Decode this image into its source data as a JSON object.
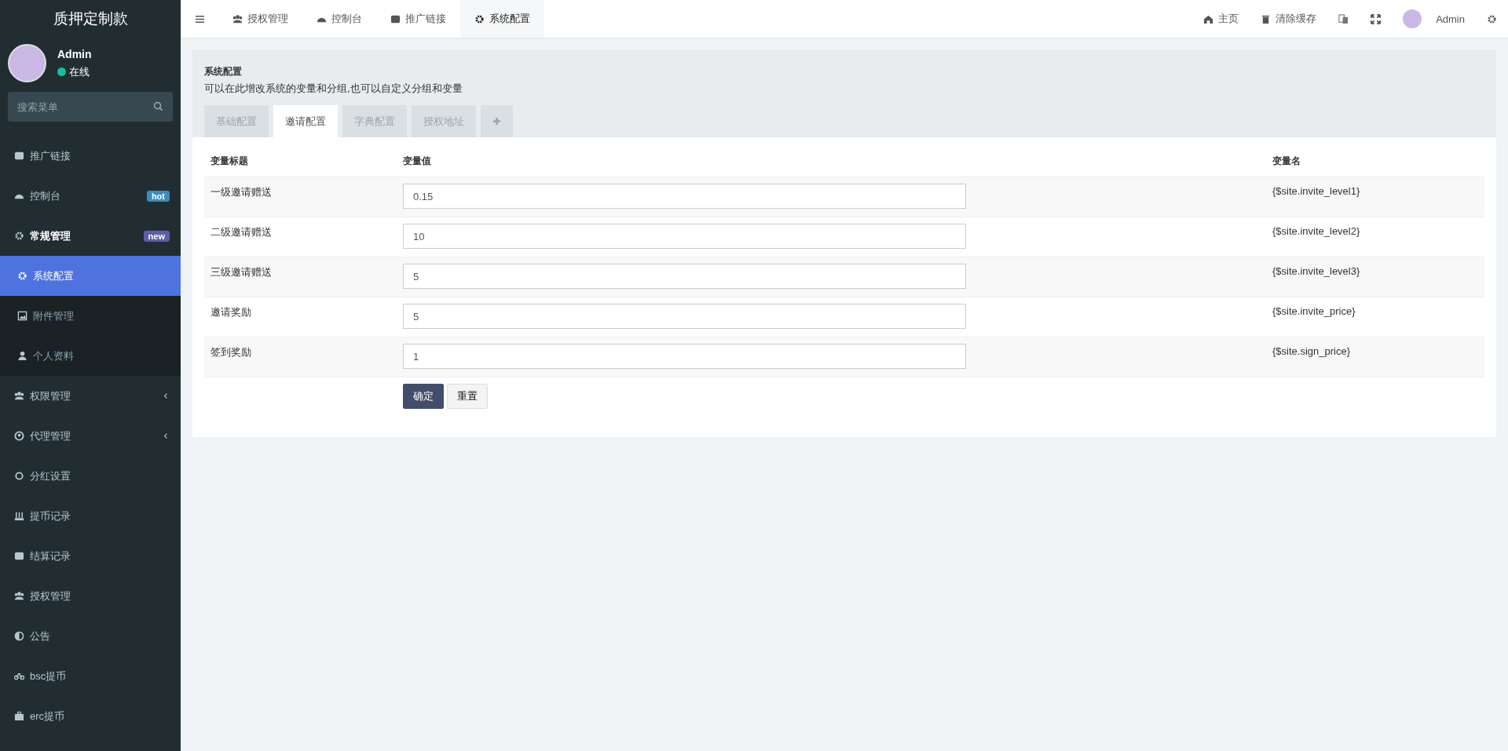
{
  "brand": "质押定制款",
  "user": {
    "name": "Admin",
    "status": "在线"
  },
  "sidebar": {
    "search": {
      "placeholder": "搜索菜单"
    },
    "items": [
      {
        "label": "推广链接",
        "selected": false
      },
      {
        "label": "控制台",
        "badge": {
          "label": "hot",
          "color": "#3c8dbc"
        },
        "selected": false
      },
      {
        "label": "常规管理",
        "badge": {
          "label": "new",
          "color": "#605ca8"
        },
        "selected": false,
        "expanded": true,
        "children": [
          {
            "label": "系统配置",
            "selected": true
          },
          {
            "label": "附件管理",
            "selected": false
          },
          {
            "label": "个人资料",
            "selected": false
          }
        ]
      },
      {
        "label": "权限管理",
        "selected": false,
        "expanded": false,
        "has_children": true
      },
      {
        "label": "代理管理",
        "selected": false,
        "expanded": false,
        "has_children": true
      },
      {
        "label": "分红设置",
        "selected": false
      },
      {
        "label": "提币记录",
        "selected": false
      },
      {
        "label": "结算记录",
        "selected": false
      },
      {
        "label": "授权管理",
        "selected": false
      },
      {
        "label": "公告",
        "selected": false
      },
      {
        "label": "bsc提币",
        "selected": false
      },
      {
        "label": "erc提币",
        "selected": false
      }
    ]
  },
  "top_tabs": [
    {
      "label": "授权管理",
      "selected": false
    },
    {
      "label": "控制台",
      "selected": false
    },
    {
      "label": "推广链接",
      "selected": false
    },
    {
      "label": "系统配置",
      "selected": true
    }
  ],
  "top_right": {
    "home": "主页",
    "clear_cache": "清除缓存",
    "user": "Admin"
  },
  "panel": {
    "title": "系统配置",
    "description": "可以在此增改系统的变量和分组,也可以自定义分组和变量",
    "tabs": [
      {
        "label": "基础配置",
        "selected": false
      },
      {
        "label": "邀请配置",
        "selected": true
      },
      {
        "label": "字典配置",
        "selected": false
      },
      {
        "label": "授权地址",
        "selected": false
      }
    ],
    "columns": [
      "变量标题",
      "变量值",
      "变量名"
    ],
    "rows": [
      {
        "title": "一级邀请赠送",
        "value": "0.15",
        "name": "{$site.invite_level1}"
      },
      {
        "title": "二级邀请赠送",
        "value": "10",
        "name": "{$site.invite_level2}"
      },
      {
        "title": "三级邀请赠送",
        "value": "5",
        "name": "{$site.invite_level3}"
      },
      {
        "title": "邀请奖励",
        "value": "5",
        "name": "{$site.invite_price}"
      },
      {
        "title": "签到奖励",
        "value": "1",
        "name": "{$site.sign_price}"
      }
    ],
    "buttons": [
      "确定",
      "重置"
    ]
  }
}
